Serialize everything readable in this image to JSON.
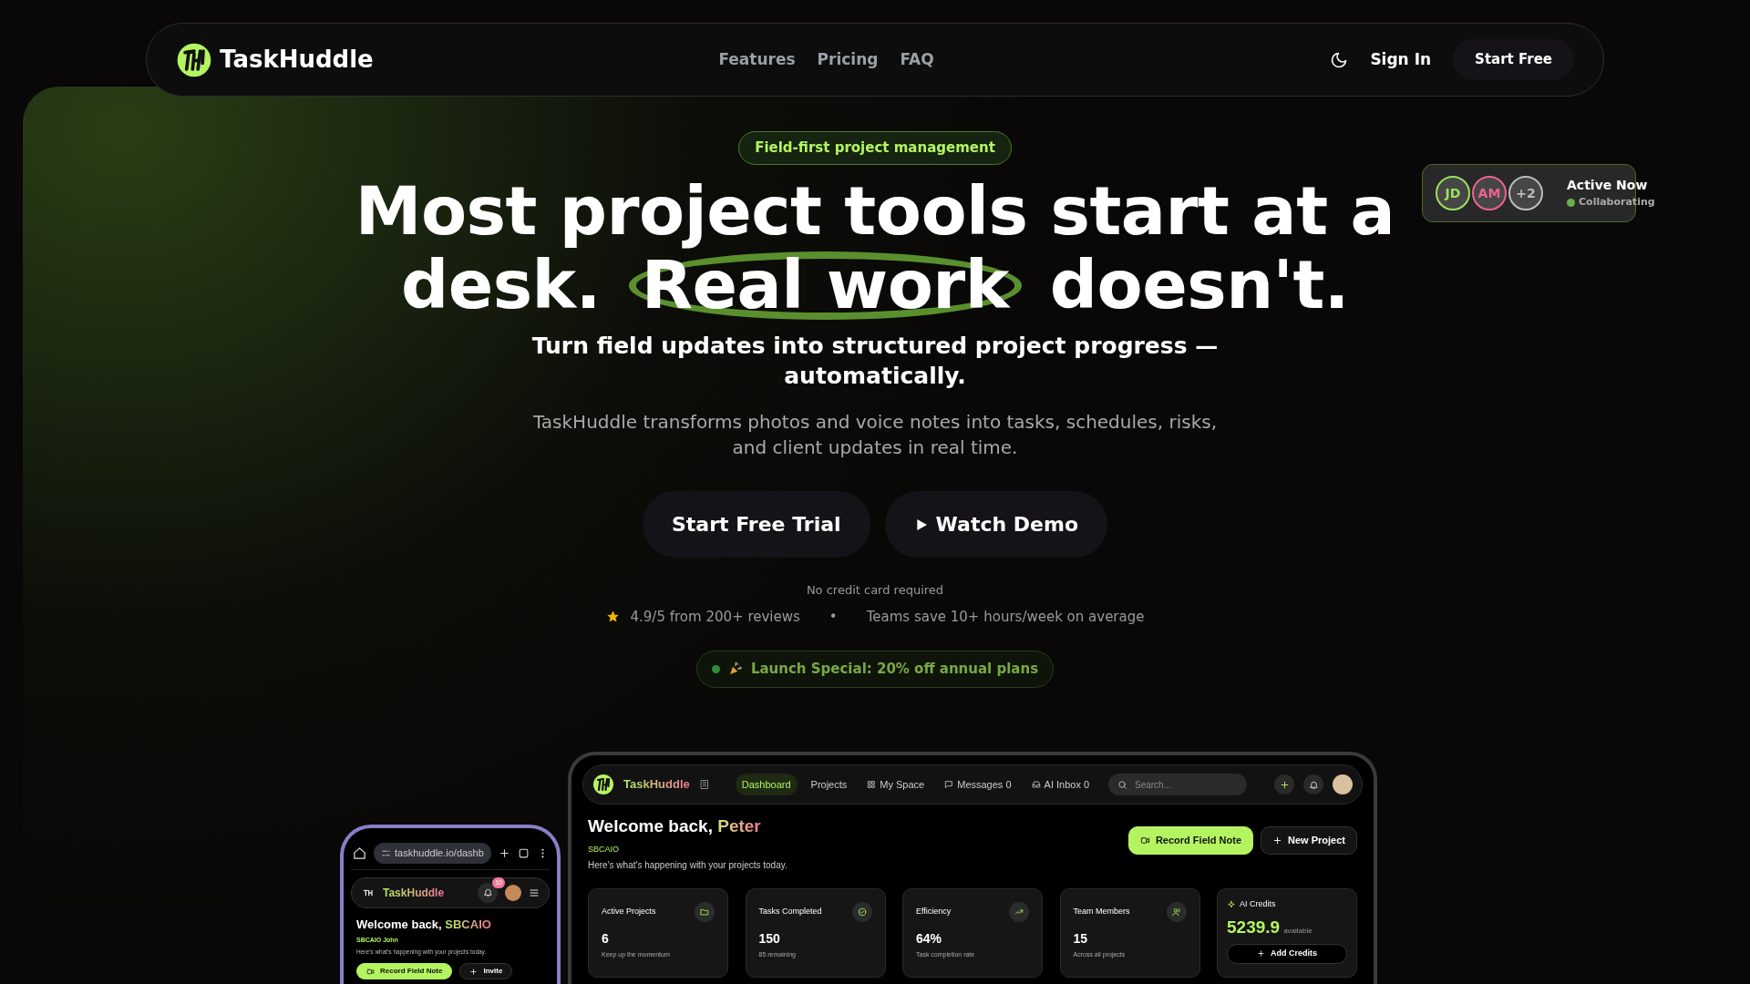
{
  "navbar": {
    "brand": "TaskHuddle",
    "links": [
      "Features",
      "Pricing",
      "FAQ"
    ],
    "sign_in": "Sign In",
    "cta": "Start Free"
  },
  "hero": {
    "badge": "Field-first project management",
    "headline": {
      "first_line": "Most project tools start at a",
      "lead": "desk.",
      "highlight": "Real work",
      "after": "doesn't."
    },
    "subtitle": "Turn field updates into structured project progress — automatically.",
    "description": "TaskHuddle transforms photos and voice notes into tasks, schedules, risks, and client updates in real time.",
    "buttons": [
      {
        "label": "Start Free Trial",
        "kind": "primary"
      },
      {
        "label": "Watch Demo",
        "kind": "play"
      }
    ],
    "note": "No credit card required",
    "proof": [
      "4.9/5 from 200+ reviews",
      "Teams save 10+ hours/week on average"
    ],
    "separator": "•",
    "promo": "Launch Special: 20% off annual plans"
  },
  "presence": {
    "avatars": [
      {
        "initials": "JD",
        "color": "#9be15d"
      },
      {
        "initials": "AM",
        "color": "#f06292"
      },
      {
        "initials": "+2",
        "color": "#bdbdbd"
      }
    ],
    "title": "Active Now",
    "status": "Collaborating"
  },
  "dashboard": {
    "brand": "TaskHuddle",
    "nav": [
      {
        "label": "Dashboard",
        "selected": true
      },
      {
        "label": "Projects",
        "selected": false
      },
      {
        "label": "My Space",
        "selected": false
      },
      {
        "label": "Messages",
        "count": "0",
        "selected": false
      },
      {
        "label": "AI Inbox",
        "count": "0",
        "selected": false
      }
    ],
    "search": {
      "placeholder": "Search..."
    },
    "greeting": "Welcome back,",
    "name": "Peter",
    "org": "SBCAIO",
    "intro": "Here's what's happening with your projects today.",
    "actions": [
      {
        "label": "Record Field Note",
        "kind": "primary"
      },
      {
        "label": "New Project",
        "kind": "secondary"
      }
    ],
    "stats": [
      {
        "label": "Active Projects",
        "value": "6",
        "note": "Keep up the momentum"
      },
      {
        "label": "Tasks Completed",
        "value": "150",
        "note": "85 remaining"
      },
      {
        "label": "Efficiency",
        "value": "64%",
        "note": "Task completion rate"
      },
      {
        "label": "Team Members",
        "value": "15",
        "note": "Across all projects"
      }
    ],
    "credits": {
      "title": "AI Credits",
      "value": "5239.9",
      "unit": "available",
      "button": "Add Credits"
    }
  },
  "phone": {
    "url": "taskhuddle.io/dashb",
    "brand": "TaskHuddle",
    "notifications": "10",
    "greeting": "Welcome back,",
    "name": "SBCAIO",
    "user": "SBCAIO John",
    "intro": "Here's what's happening with your projects today.",
    "actions": [
      {
        "label": "Record Field Note",
        "kind": "primary"
      },
      {
        "label": "Invite",
        "kind": "secondary"
      }
    ]
  }
}
